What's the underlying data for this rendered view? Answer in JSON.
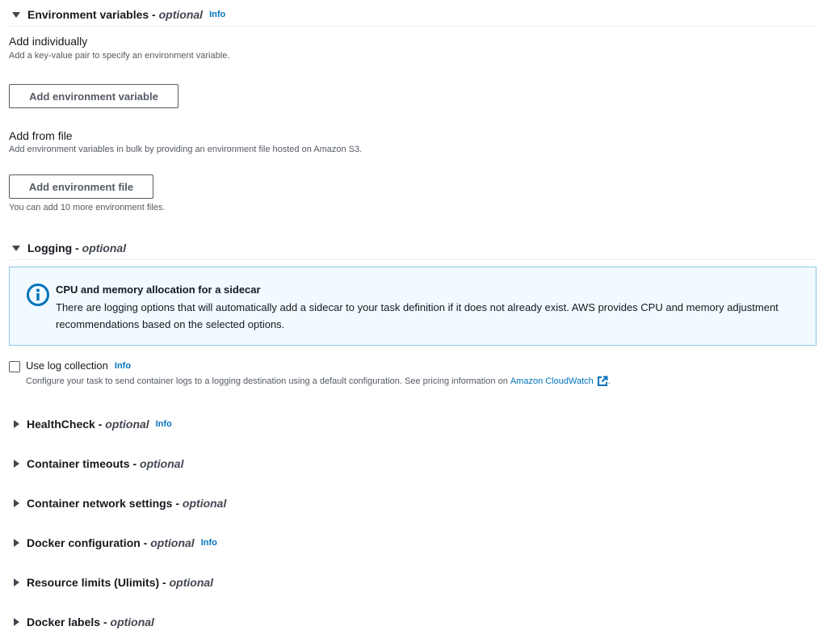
{
  "env_section": {
    "title": "Environment variables",
    "dash": " - ",
    "optional": "optional",
    "info": "Info",
    "add_individually_label": "Add individually",
    "add_individually_desc": "Add a key-value pair to specify an environment variable.",
    "add_variable_button": "Add environment variable",
    "add_from_file_label": "Add from file",
    "add_from_file_desc": "Add environment variables in bulk by providing an environment file hosted on Amazon S3.",
    "add_file_button": "Add environment file",
    "files_remaining": "You can add 10 more environment files."
  },
  "logging_section": {
    "title": "Logging",
    "dash": " - ",
    "optional": "optional",
    "alert_title": "CPU and memory allocation for a sidecar",
    "alert_body": "There are logging options that will automatically add a sidecar to your task definition if it does not already exist. AWS provides CPU and memory adjustment recommendations based on the selected options.",
    "checkbox_label": "Use log collection",
    "checkbox_info": "Info",
    "checkbox_desc": "Configure your task to send container logs to a logging destination using a default configuration. See pricing information on",
    "checkbox_link": "Amazon CloudWatch",
    "checkbox_period": "."
  },
  "collapsed_sections": [
    {
      "title": "HealthCheck",
      "dash": " - ",
      "optional": "optional",
      "info": "Info"
    },
    {
      "title": "Container timeouts",
      "dash": " - ",
      "optional": "optional",
      "info": ""
    },
    {
      "title": "Container network settings",
      "dash": " - ",
      "optional": "optional",
      "info": ""
    },
    {
      "title": "Docker configuration",
      "dash": " - ",
      "optional": "optional",
      "info": "Info"
    },
    {
      "title": "Resource limits (Ulimits)",
      "dash": " - ",
      "optional": "optional",
      "info": ""
    },
    {
      "title": "Docker labels",
      "dash": " - ",
      "optional": "optional",
      "info": ""
    }
  ],
  "colors": {
    "link": "#0073bb",
    "alert_border": "#8cc7e4",
    "alert_bg": "#f1faff"
  },
  "icons": {
    "expanded": "caret-down-icon",
    "collapsed": "caret-right-icon",
    "alert": "info-circle-icon",
    "external": "external-link-icon"
  }
}
